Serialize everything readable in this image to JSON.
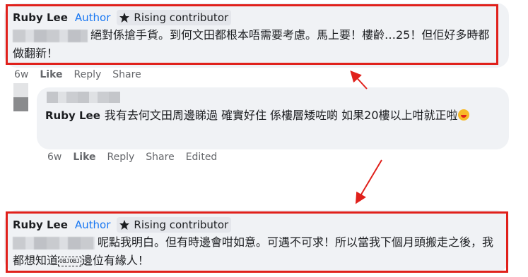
{
  "colors": {
    "highlight": "#e0201b",
    "author": "#1877f2",
    "bubble": "#f0f2f5",
    "meta": "#65676b"
  },
  "comment1": {
    "name": "Ruby Lee",
    "author_label": "Author",
    "badge_label": "Rising contributor",
    "badge_icon": "star-icon",
    "text": "絕對係搶手貨。到何文田都根本唔需要考慮。馬上要！樓齡…25！但佢好多時都做翻新！",
    "actions": {
      "time": "6w",
      "like": "Like",
      "reply": "Reply",
      "share": "Share"
    }
  },
  "reply": {
    "name": "Ruby Lee",
    "text": "我有去何文田周邊睇過 確實好住 係樓層矮咗啲 如果20樓以上咁就正啦",
    "actions": {
      "time": "6w",
      "like": "Like",
      "reply": "Reply",
      "share": "Share",
      "edited": "Edited"
    }
  },
  "comment2": {
    "name": "Ruby Lee",
    "author_label": "Author",
    "badge_label": "Rising contributor",
    "badge_icon": "star-icon",
    "text_before": "呢點我明白。但有時邊會咁如意。可遇不可求！所以當我下個月頭搬走之後，我都想知道",
    "placeholder": "OBJOBJ",
    "text_after": "邊位有緣人！"
  }
}
